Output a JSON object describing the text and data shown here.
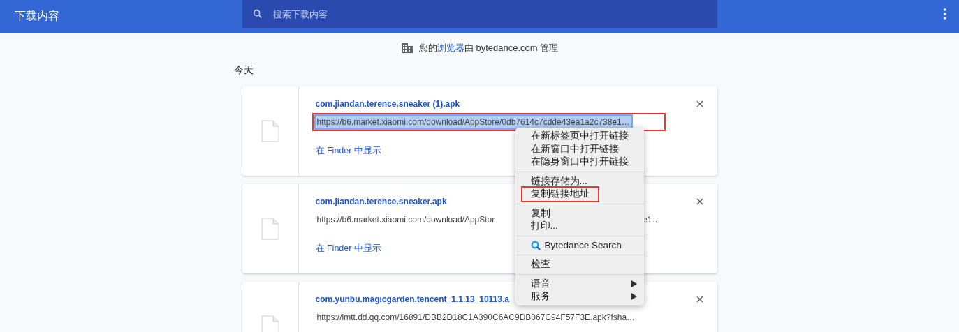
{
  "header": {
    "title": "下载内容",
    "search": {
      "placeholder": "搜索下载内容"
    }
  },
  "managed_notice": {
    "before": "您的",
    "link": "浏览器",
    "after": "由 bytedance.com 管理"
  },
  "section_title": "今天",
  "downloads": [
    {
      "name": "com.jiandan.terence.sneaker (1).apk",
      "url": "https://b6.market.xiaomi.com/download/AppStore/0db7614c7cdde43ea1a2c738e1…",
      "url_selected": true,
      "highlighted": true,
      "action": "在 Finder 中显示"
    },
    {
      "name": "com.jiandan.terence.sneaker.apk",
      "url": "https://b6.market.xiaomi.com/download/AppStor",
      "url_end": "e1…",
      "url_selected": false,
      "highlighted": false,
      "action": "在 Finder 中显示"
    },
    {
      "name": "com.yunbu.magicgarden.tencent_1.1.13_10113.a",
      "url": "https://imtt.dd.qq.com/16891/DBB2D18C1A390C6AC9DB067C94F57F3E.apk?fsha…",
      "url_selected": false,
      "highlighted": false
    }
  ],
  "context_menu": {
    "groups": [
      [
        {
          "label": "在新标签页中打开链接",
          "highlighted": false
        },
        {
          "label": "在新窗口中打开链接",
          "highlighted": false
        },
        {
          "label": "在隐身窗口中打开链接",
          "highlighted": false
        }
      ],
      [
        {
          "label": "链接存储为...",
          "highlighted": false
        },
        {
          "label": "复制链接地址",
          "highlighted": true
        }
      ],
      [
        {
          "label": "复制",
          "highlighted": false
        },
        {
          "label": "打印...",
          "highlighted": false
        }
      ],
      [
        {
          "label": "Bytedance Search",
          "kind": "icon",
          "highlighted": false
        }
      ],
      [
        {
          "label": "检查",
          "highlighted": false
        }
      ],
      [
        {
          "label": "语音",
          "kind": "submenu",
          "highlighted": false
        },
        {
          "label": "服务",
          "kind": "submenu",
          "highlighted": false
        }
      ]
    ]
  }
}
